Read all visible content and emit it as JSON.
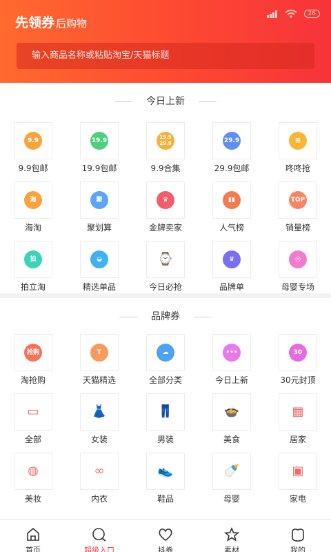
{
  "header": {
    "title_bold": "先领券",
    "title_normal": "后购物",
    "battery": "26",
    "search_placeholder": "输入商品名称或粘贴淘宝/天猫标题"
  },
  "section1": {
    "title": "今日上新",
    "items": [
      {
        "label": "9.9包邮",
        "badge": "9.9",
        "color": "#f7a43c",
        "icon": "badge-9-9-icon"
      },
      {
        "label": "19.9包邮",
        "badge": "19.9",
        "color": "#4cd07b",
        "icon": "badge-19-9-icon"
      },
      {
        "label": "9.9合集",
        "badge": "19.9 29.9",
        "color": "#f5b13b",
        "icon": "badge-collection-icon"
      },
      {
        "label": "29.9包邮",
        "badge": "29.9",
        "color": "#5f8ff5",
        "icon": "badge-29-9-icon"
      },
      {
        "label": "咚咚抢",
        "badge": "⊞",
        "color": "#f9b534",
        "icon": "flash-grab-icon"
      },
      {
        "label": "海淘",
        "badge": "海",
        "color": "#f7a43c",
        "icon": "overseas-icon"
      },
      {
        "label": "聚划算",
        "badge": "聚",
        "color": "#5da4f5",
        "icon": "group-deal-icon"
      },
      {
        "label": "金牌卖家",
        "badge": "♛",
        "color": "#f25d6a",
        "icon": "gold-seller-icon"
      },
      {
        "label": "人气榜",
        "badge": "▮▮",
        "color": "#f47b4f",
        "icon": "popularity-chart-icon"
      },
      {
        "label": "销量榜",
        "badge": "TOP",
        "color": "#f58664",
        "icon": "sales-top-icon"
      },
      {
        "label": "拍立淘",
        "badge": "拍",
        "color": "#3ad3b6",
        "icon": "photo-search-icon"
      },
      {
        "label": "精选单品",
        "badge": "◒",
        "color": "#3fb3f0",
        "icon": "basket-icon"
      },
      {
        "label": "今日必抢",
        "badge": "⌚",
        "color": "#ffffff",
        "icon": "today-must-grab-icon"
      },
      {
        "label": "品牌单",
        "badge": "♛",
        "color": "#7b6ff0",
        "icon": "brand-crown-icon"
      },
      {
        "label": "母婴专场",
        "badge": "◎",
        "color": "#f37bcf",
        "icon": "baby-stroller-icon"
      }
    ]
  },
  "section2": {
    "title": "品牌券",
    "items": [
      {
        "label": "淘抢购",
        "badge": "抢购",
        "color": "#f5735b",
        "icon": "taoqiang-icon"
      },
      {
        "label": "天猫精选",
        "badge": "T",
        "color": "#f79a5c",
        "icon": "tmall-select-icon"
      },
      {
        "label": "全部分类",
        "badge": "☁",
        "color": "#4ea3f0",
        "icon": "all-categories-icon"
      },
      {
        "label": "今日上新",
        "badge": "•••",
        "color": "#e978ea",
        "icon": "today-new-icon"
      },
      {
        "label": "30元封顶",
        "badge": "30",
        "color": "#e76be0",
        "icon": "thirty-cap-icon"
      },
      {
        "label": "全部",
        "badge": "▭",
        "color": "#ffffff",
        "icon": "tray-icon"
      },
      {
        "label": "女装",
        "badge": "👗",
        "color": "#ffffff",
        "icon": "dress-icon"
      },
      {
        "label": "男装",
        "badge": "👖",
        "color": "#ffffff",
        "icon": "pants-icon"
      },
      {
        "label": "美食",
        "badge": "🍲",
        "color": "#ffffff",
        "icon": "food-bowl-icon"
      },
      {
        "label": "居家",
        "badge": "▦",
        "color": "#ffffff",
        "icon": "home-goods-icon"
      },
      {
        "label": "美妆",
        "badge": "◍",
        "color": "#ffffff",
        "icon": "cosmetics-icon"
      },
      {
        "label": "内衣",
        "badge": "∞",
        "color": "#ffffff",
        "icon": "lingerie-icon"
      },
      {
        "label": "鞋品",
        "badge": "👟",
        "color": "#ffffff",
        "icon": "shoe-icon"
      },
      {
        "label": "母婴",
        "badge": "🍼",
        "color": "#ffffff",
        "icon": "baby-bottle-icon"
      },
      {
        "label": "家电",
        "badge": "▣",
        "color": "#ffffff",
        "icon": "appliance-icon"
      }
    ]
  },
  "tabbar": {
    "tabs": [
      {
        "label": "首页",
        "icon": "home-icon"
      },
      {
        "label": "超级入口",
        "icon": "super-entry-icon",
        "active": true
      },
      {
        "label": "抖券",
        "icon": "heart-icon"
      },
      {
        "label": "素材",
        "icon": "star-icon"
      },
      {
        "label": "我的",
        "icon": "profile-icon"
      }
    ]
  },
  "colors": {
    "header_start": "#ff6a2f",
    "header_end": "#f7333a",
    "active_tab": "#f5333a"
  }
}
